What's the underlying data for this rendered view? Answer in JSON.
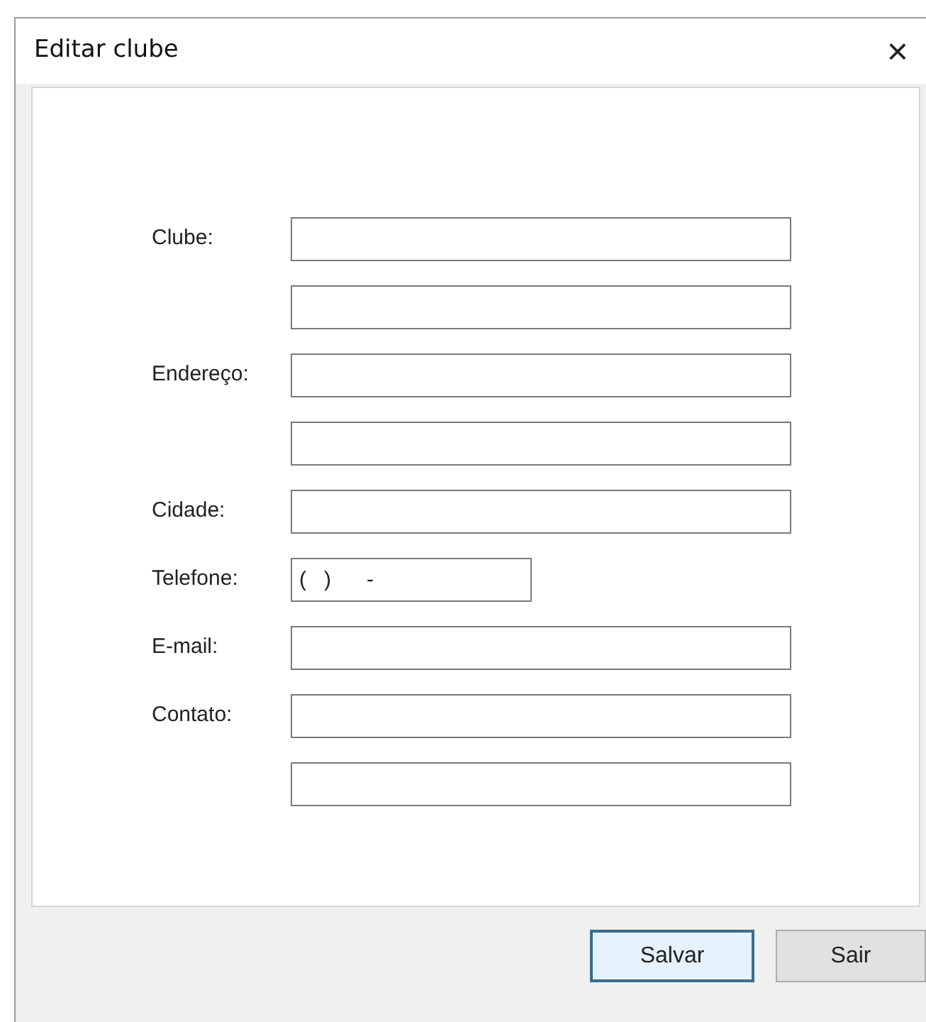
{
  "window": {
    "title": "Editar clube",
    "close": "×"
  },
  "fields": [
    {
      "kind": "full",
      "label": "Clube:"
    },
    {
      "kind": "full"
    },
    {
      "kind": "full",
      "label": "Endereço:"
    },
    {
      "kind": "full"
    },
    {
      "kind": "full",
      "label": "Cidade:"
    },
    {
      "kind": "short",
      "label": "Telefone:",
      "value": "(   )      -"
    },
    {
      "kind": "full",
      "label": "E-mail:"
    },
    {
      "kind": "full",
      "label": "Contato:"
    },
    {
      "kind": "full"
    }
  ],
  "buttons": [
    {
      "label": "Salvar",
      "default": true
    },
    {
      "label": "Sair",
      "default": false
    }
  ]
}
